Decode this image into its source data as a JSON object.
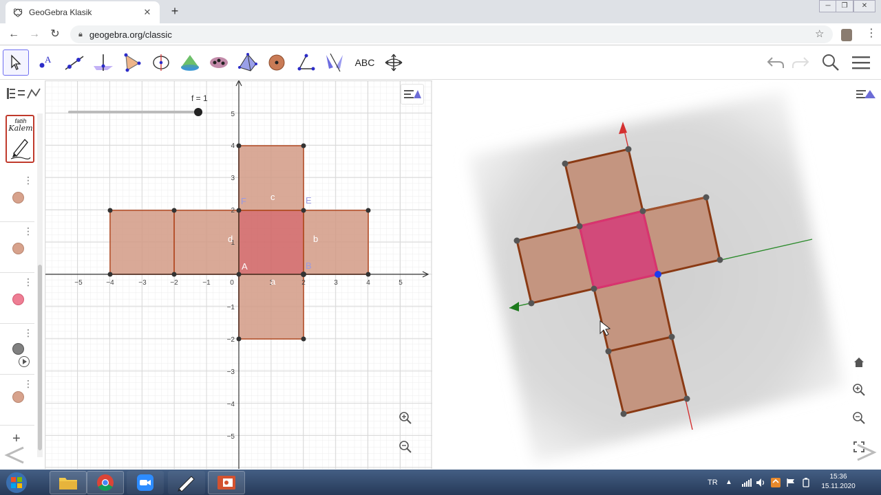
{
  "browser": {
    "tab_title": "GeoGebra Klasik",
    "tab_close": "✕",
    "new_tab": "+",
    "url": "geogebra.org/classic",
    "window_controls": [
      "─",
      "❐",
      "✕"
    ]
  },
  "toolbar": {
    "tools": [
      "move",
      "point",
      "line",
      "perpendicular",
      "polygon",
      "circle",
      "conic",
      "measure",
      "reflect",
      "slider",
      "abc",
      "move-view"
    ],
    "text_tool_label": "ABC"
  },
  "left_panel": {
    "pen_label_1": "fatih",
    "pen_label_2": "Kalem",
    "objects": [
      {
        "color": "#d7a28c"
      },
      {
        "color": "#d7a28c"
      },
      {
        "color": "#ee7e94"
      },
      {
        "color": "#808080"
      },
      {
        "color": "#d7a28c"
      }
    ],
    "add_button": "+"
  },
  "graphics2d": {
    "slider_label": "f = 1",
    "slider_value": 1,
    "x_ticks": [
      "−5",
      "−4",
      "−3",
      "−2",
      "−1",
      "0",
      "1",
      "2",
      "3",
      "4",
      "5"
    ],
    "y_ticks": [
      "5",
      "4",
      "3",
      "2",
      "1",
      "−1",
      "−2",
      "−3",
      "−4",
      "−5"
    ],
    "labels": {
      "A": "A",
      "B": "B",
      "E": "E",
      "F": "F",
      "a": "a",
      "b": "b",
      "c": "c",
      "d": "d"
    },
    "net_color": "#d39b86",
    "base_color": "#d26a6a",
    "edge_color": "#b5502a"
  },
  "graphics3d": {
    "face_color": "#c49580",
    "base_color": "#d24a7a"
  },
  "taskbar": {
    "lang": "TR",
    "time": "15:36",
    "date": "15.11.2020"
  }
}
